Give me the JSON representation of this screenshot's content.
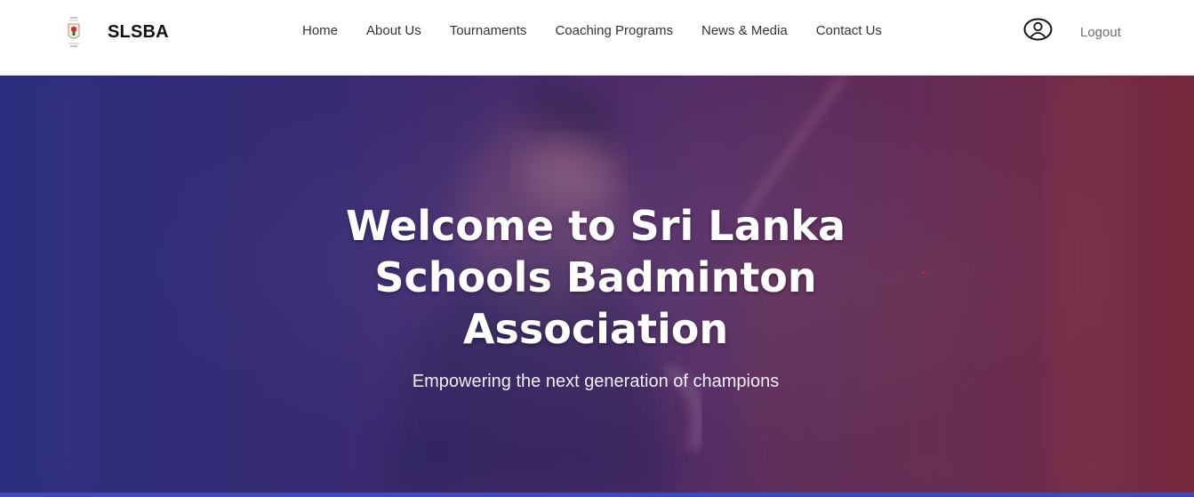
{
  "header": {
    "brand_name": "SLSBA",
    "logo_icon": "slsba-crest-logo",
    "nav": [
      {
        "label": "Home"
      },
      {
        "label": "About Us"
      },
      {
        "label": "Tournaments"
      },
      {
        "label": "Coaching Programs"
      },
      {
        "label": "News & Media"
      },
      {
        "label": "Contact Us"
      }
    ],
    "user_icon": "user-circle-icon",
    "logout_label": "Logout"
  },
  "hero": {
    "title": "Welcome to Sri Lanka Schools Badminton Association",
    "subtitle": "Empowering the next generation of champions",
    "gradient_colors": [
      "#2b2d7e",
      "#3a2b72",
      "#5a2d62",
      "#772a3e"
    ],
    "accent_line_color": "#3f49b8"
  }
}
